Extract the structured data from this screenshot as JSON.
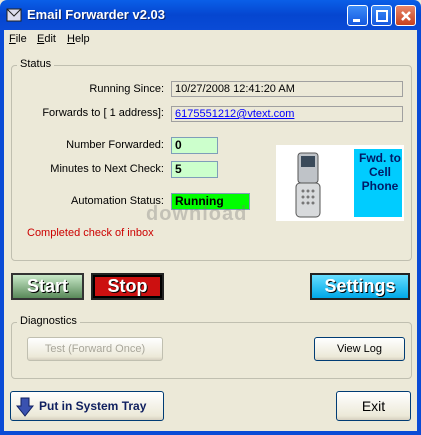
{
  "window": {
    "title": "Email Forwarder v2.03",
    "controls": {
      "minimize": "minimize-icon",
      "maximize": "maximize-icon",
      "close": "close-icon"
    }
  },
  "menu": [
    {
      "label": "File",
      "accel": "F",
      "rest": "ile"
    },
    {
      "label": "Edit",
      "accel": "E",
      "rest": "dit"
    },
    {
      "label": "Help",
      "accel": "H",
      "rest": "elp"
    }
  ],
  "status": {
    "group_label": "Status",
    "running_since_label": "Running Since:",
    "running_since_value": "10/27/2008 12:41:20 AM",
    "forwards_to_label": "Forwards to [ 1 address]:",
    "forwards_to_value": "6175551212@vtext.com",
    "number_forwarded_label": "Number Forwarded:",
    "number_forwarded_value": "0",
    "minutes_next_check_label": "Minutes to Next Check:",
    "minutes_next_check_value": "5",
    "automation_status_label": "Automation Status:",
    "automation_status_value": "Running",
    "message": "Completed check of inbox",
    "image_text": "Fwd. to Cell Phone",
    "watermark": "download"
  },
  "buttons": {
    "start": "Start",
    "stop": "Stop",
    "settings": "Settings"
  },
  "diagnostics": {
    "group_label": "Diagnostics",
    "test_button": "Test (Forward Once)",
    "view_log_button": "View Log"
  },
  "footer": {
    "tray_button": "Put in System Tray",
    "exit_button": "Exit"
  },
  "colors": {
    "message_red": "#cc0000",
    "link_blue": "#0000ff",
    "running_green": "#00ff00",
    "image_text_blue": "#001a66"
  }
}
